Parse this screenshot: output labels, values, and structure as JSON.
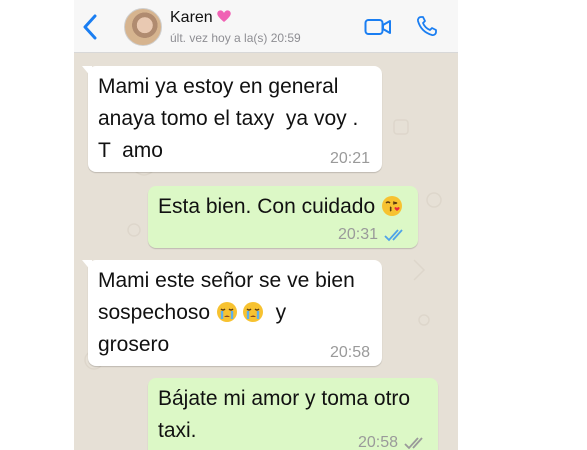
{
  "header": {
    "contact_name": "Karen",
    "last_seen": "últ. vez hoy a la(s) 20:59"
  },
  "messages": [
    {
      "direction": "in",
      "lines": [
        "Mami ya estoy en general",
        "anaya tomo el taxy  ya voy .",
        "T  amo"
      ],
      "time": "20:21"
    },
    {
      "direction": "out",
      "text": "Esta bien. Con cuidado",
      "emoji": "kiss-emoji",
      "time": "20:31",
      "status": "read"
    },
    {
      "direction": "in",
      "line1": "Mami este señor se ve bien",
      "line2_before": "sospechoso",
      "line2_after": "y",
      "line3": "grosero",
      "emoji": "crying-emoji",
      "time": "20:58"
    },
    {
      "direction": "out",
      "lines": [
        "Bájate mi amor y toma otro",
        "taxi."
      ],
      "time": "20:58",
      "status": "delivered"
    }
  ],
  "colors": {
    "chat_background": "#e6e0d6",
    "incoming_bubble": "#ffffff",
    "outgoing_bubble": "#dcf8c6",
    "accent_blue": "#1a7ef2"
  }
}
